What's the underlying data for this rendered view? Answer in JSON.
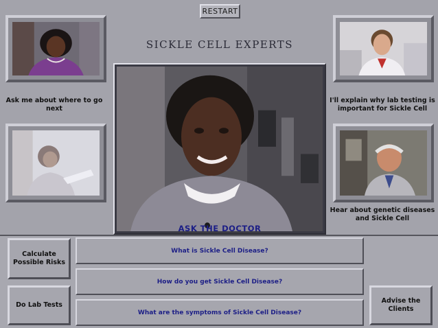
{
  "header": {
    "restart_label": "RESTART",
    "title": "SICKLE CELL EXPERTS"
  },
  "experts": {
    "top_left_caption": "Ask me about where to go next",
    "top_right_caption": "I'll explain why lab testing is important for Sickle Cell",
    "bottom_right_caption": "Hear about genetic diseases and Sickle Cell"
  },
  "main_video": {
    "label": "ASK THE DOCTOR"
  },
  "questions": [
    {
      "label": "What is Sickle Cell Disease?"
    },
    {
      "label": "How do you get Sickle Cell Disease?"
    },
    {
      "label": "What are the symptoms of Sickle Cell Disease?"
    }
  ],
  "side_buttons": {
    "calculate_label": "Calculate Possible Risks",
    "lab_tests_label": "Do Lab Tests",
    "advise_label": "Advise the Clients"
  },
  "colors": {
    "background": "#a3a3ab",
    "accent_text": "#1c1e86"
  }
}
